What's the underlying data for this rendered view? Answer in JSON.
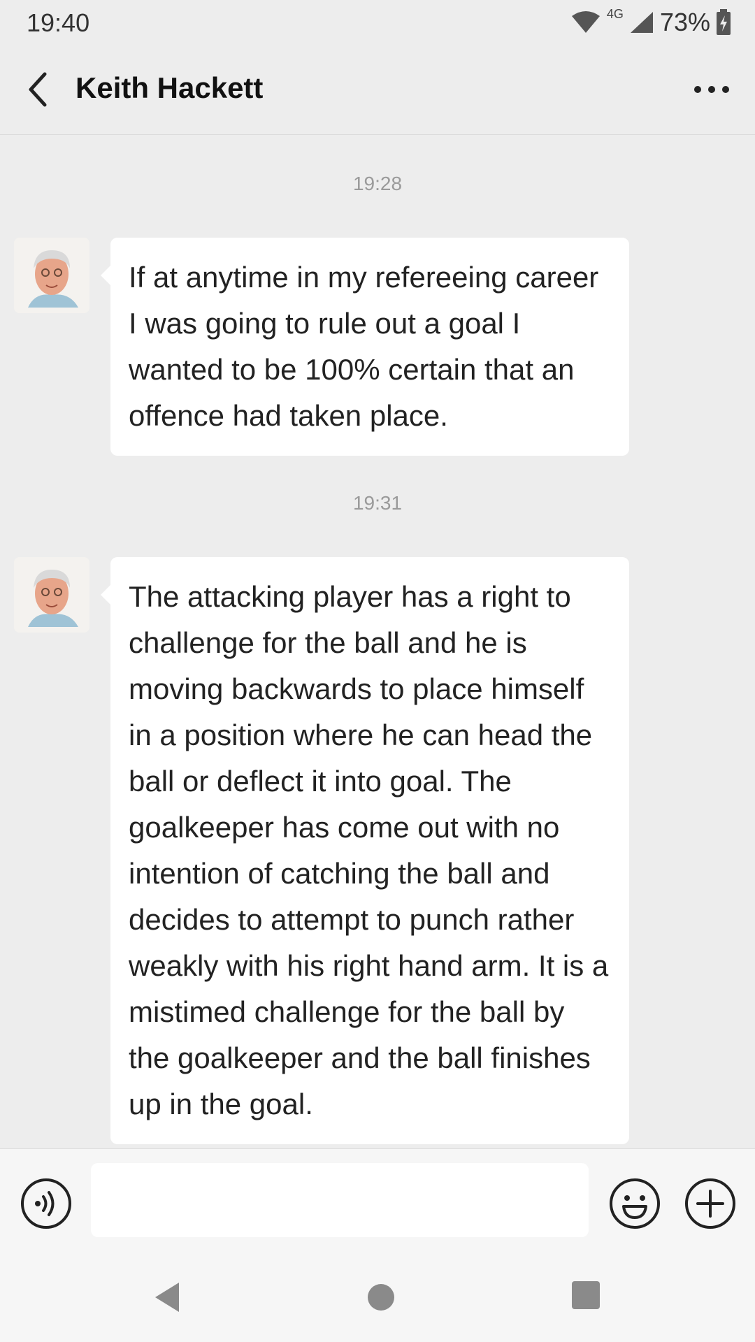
{
  "status_bar": {
    "time": "19:40",
    "network": "4G",
    "battery": "73%",
    "icons": [
      "wifi-icon",
      "signal-icon",
      "battery-charging-icon"
    ]
  },
  "header": {
    "title": "Keith Hackett",
    "back_icon": "chevron-left-icon",
    "more_icon": "more-horizontal-icon"
  },
  "messages": [
    {
      "timestamp": "19:28",
      "text": "If at anytime in my refereeing career I was going to rule out a goal I wanted to be 100% certain that an offence had taken place."
    },
    {
      "timestamp": "19:31",
      "text": "The attacking player has a right to challenge for the ball and he is moving backwards to place himself in a position where he can head the ball or deflect it into goal. The goalkeeper has come out with no intention of catching the ball and decides to attempt to punch rather weakly with his right hand arm. It is a mistimed challenge for the ball by the goalkeeper and the ball finishes up in the goal."
    }
  ],
  "input_bar": {
    "value": "",
    "voice_icon": "voice-icon",
    "emoji_icon": "emoji-icon",
    "plus_icon": "plus-icon"
  },
  "nav_bar": {
    "icons": [
      "nav-back-icon",
      "nav-home-icon",
      "nav-recent-icon"
    ]
  }
}
